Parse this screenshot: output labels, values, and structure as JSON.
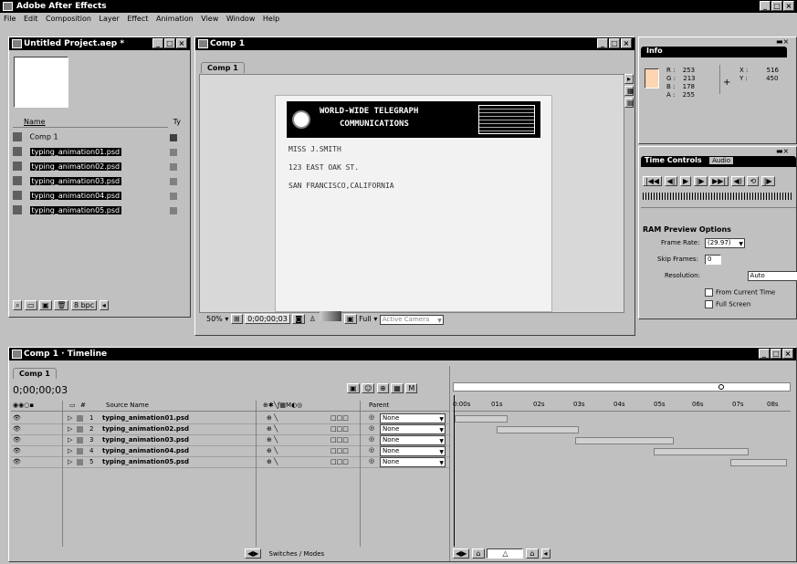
{
  "app": {
    "title": "Adobe After Effects"
  },
  "menu": [
    "File",
    "Edit",
    "Composition",
    "Layer",
    "Effect",
    "Animation",
    "View",
    "Window",
    "Help"
  ],
  "project": {
    "title": "Untitled Project.aep *",
    "col_name": "Name",
    "col_type": "Ty",
    "items": [
      "Comp 1",
      "typing_animation01.psd",
      "typing_animation02.psd",
      "typing_animation03.psd",
      "typing_animation04.psd",
      "typing_animation05.psd"
    ],
    "bpc": "8 bpc"
  },
  "comp": {
    "title": "Comp 1",
    "tab": "Comp 1",
    "zoom": "50%",
    "timecode": "0;00;00;03",
    "resolution": "Full",
    "camera": "Active Camera",
    "telegram": {
      "heading1": "WORLD-WIDE TELEGRAPH",
      "heading2": "COMMUNICATIONS",
      "line1": "MISS J.SMITH",
      "line2": "123 EAST OAK ST.",
      "line3": "SAN FRANCISCO,CALIFORNIA"
    }
  },
  "info": {
    "tab": "Info",
    "r_label": "R :",
    "r": "253",
    "g_label": "G :",
    "g": "213",
    "b_label": "B :",
    "b": "178",
    "a_label": "A :",
    "a": "255",
    "x_label": "X :",
    "x": "516",
    "y_label": "Y :",
    "y": "450"
  },
  "time_controls": {
    "tab": "Time Controls",
    "tab2": "Audio",
    "ram_heading": "RAM Preview Options",
    "frame_rate_label": "Frame Rate:",
    "frame_rate": "(29.97)",
    "skip_label": "Skip Frames:",
    "skip": "0",
    "res_label": "Resolution:",
    "res": "Auto",
    "from_current": "From Current Time",
    "full_screen": "Full Screen"
  },
  "timeline": {
    "title": "Comp 1 · Timeline",
    "tab": "Comp 1",
    "timecode": "0;00;00;03",
    "col_source": "Source Name",
    "col_parent": "Parent",
    "layers": [
      {
        "num": "1",
        "name": "typing_animation01.psd",
        "parent": "None"
      },
      {
        "num": "2",
        "name": "typing_animation02.psd",
        "parent": "None"
      },
      {
        "num": "3",
        "name": "typing_animation03.psd",
        "parent": "None"
      },
      {
        "num": "4",
        "name": "typing_animation04.psd",
        "parent": "None"
      },
      {
        "num": "5",
        "name": "typing_animation05.psd",
        "parent": "None"
      }
    ],
    "ruler": [
      "0:00s",
      "01s",
      "02s",
      "03s",
      "04s",
      "05s",
      "06s",
      "07s",
      "08s"
    ],
    "switches": "Switches / Modes"
  }
}
